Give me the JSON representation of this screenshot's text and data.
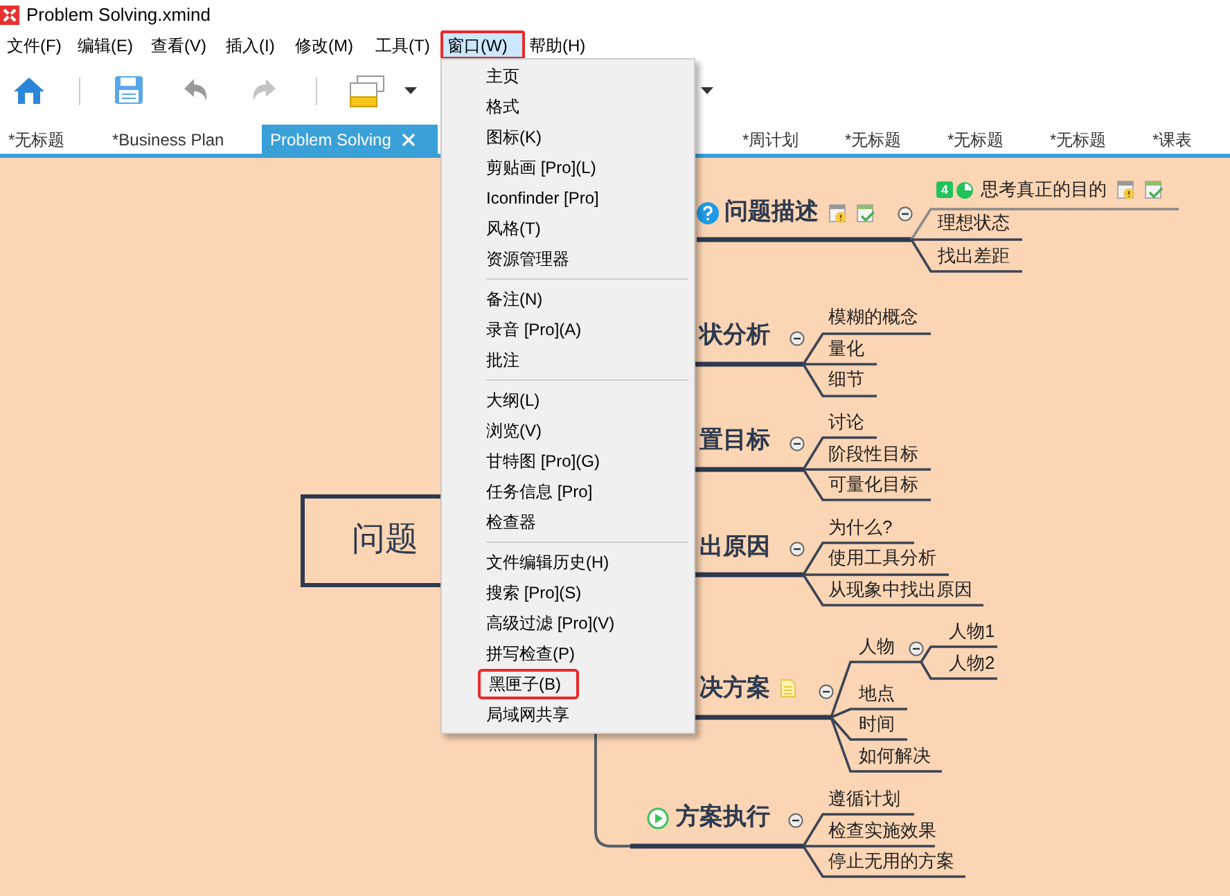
{
  "window": {
    "title": "Problem Solving.xmind"
  },
  "menu_bar": [
    {
      "label": "文件(F)",
      "selected": false,
      "annotated": false
    },
    {
      "label": "编辑(E)",
      "selected": false,
      "annotated": false
    },
    {
      "label": "查看(V)",
      "selected": false,
      "annotated": false
    },
    {
      "label": "插入(I)",
      "selected": false,
      "annotated": false
    },
    {
      "label": "修改(M)",
      "selected": false,
      "annotated": false
    },
    {
      "label": "工具(T)",
      "selected": false,
      "annotated": false
    },
    {
      "label": "窗口(W)",
      "selected": true,
      "annotated": true
    },
    {
      "label": "帮助(H)",
      "selected": false,
      "annotated": false
    }
  ],
  "tabs": [
    {
      "label": "*无标题",
      "selected": false
    },
    {
      "label": "*Business Plan",
      "selected": false
    },
    {
      "label": "Problem Solving",
      "selected": true
    },
    {
      "label": "*周计划",
      "selected": false
    },
    {
      "label": "*无标题",
      "selected": false
    },
    {
      "label": "*无标题",
      "selected": false
    },
    {
      "label": "*无标题",
      "selected": false
    },
    {
      "label": "*课表",
      "selected": false
    }
  ],
  "window_menu": {
    "sections": [
      [
        {
          "label": "主页",
          "annotated": false
        },
        {
          "label": "格式",
          "annotated": false
        },
        {
          "label": "图标(K)",
          "annotated": false
        },
        {
          "label": "剪贴画 [Pro](L)",
          "annotated": false
        },
        {
          "label": "Iconfinder [Pro]",
          "annotated": false
        },
        {
          "label": "风格(T)",
          "annotated": false
        },
        {
          "label": "资源管理器",
          "annotated": false
        }
      ],
      [
        {
          "label": "备注(N)",
          "annotated": false
        },
        {
          "label": "录音 [Pro](A)",
          "annotated": false
        },
        {
          "label": "批注",
          "annotated": false
        }
      ],
      [
        {
          "label": "大纲(L)",
          "annotated": false
        },
        {
          "label": "浏览(V)",
          "annotated": false
        },
        {
          "label": "甘特图 [Pro](G)",
          "annotated": false
        },
        {
          "label": "任务信息 [Pro]",
          "annotated": false
        },
        {
          "label": "检查器",
          "annotated": false
        }
      ],
      [
        {
          "label": "文件编辑历史(H)",
          "annotated": false
        },
        {
          "label": "搜索 [Pro](S)",
          "annotated": false
        },
        {
          "label": "高级过滤 [Pro](V)",
          "annotated": false
        },
        {
          "label": "拼写检查(P)",
          "annotated": false
        },
        {
          "label": "黑匣子(B)",
          "annotated": true
        },
        {
          "label": "局域网共享",
          "annotated": false
        }
      ]
    ]
  },
  "mind_map": {
    "central_topic": {
      "text": "问题"
    },
    "branches": [
      {
        "text": "问题描述",
        "expanded": true,
        "children": [
          {
            "text": "思考真正的目的",
            "priority": "4"
          },
          {
            "text": "理想状态"
          },
          {
            "text": "找出差距"
          }
        ]
      },
      {
        "text": "状分析",
        "expanded": true,
        "children": [
          {
            "text": "模糊的概念"
          },
          {
            "text": "量化"
          },
          {
            "text": "细节"
          }
        ]
      },
      {
        "text": "置目标",
        "expanded": true,
        "children": [
          {
            "text": "讨论"
          },
          {
            "text": "阶段性目标"
          },
          {
            "text": "可量化目标"
          }
        ]
      },
      {
        "text": "出原因",
        "expanded": true,
        "children": [
          {
            "text": "为什么?"
          },
          {
            "text": "使用工具分析"
          },
          {
            "text": "从现象中找出原因"
          }
        ]
      },
      {
        "text": "决方案",
        "expanded": true,
        "children": [
          {
            "text": "人物",
            "expanded": true,
            "children": [
              {
                "text": "人物1"
              },
              {
                "text": "人物2"
              }
            ]
          },
          {
            "text": "地点"
          },
          {
            "text": "时间"
          },
          {
            "text": "如何解决"
          }
        ]
      },
      {
        "text": "方案执行",
        "expanded": true,
        "children": [
          {
            "text": "遵循计划"
          },
          {
            "text": "检查实施效果"
          },
          {
            "text": "停止无用的方案"
          }
        ]
      }
    ]
  }
}
